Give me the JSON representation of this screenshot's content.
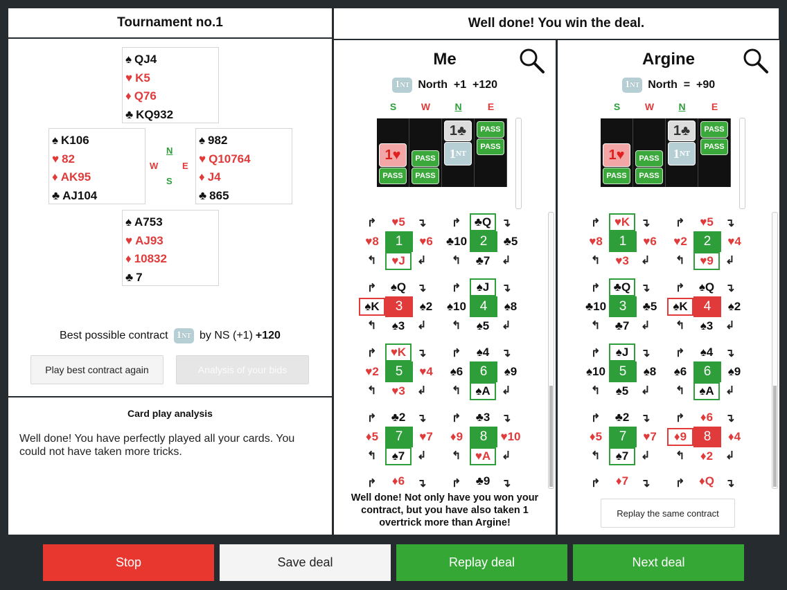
{
  "left": {
    "title": "Tournament no.1",
    "hands": {
      "north": {
        "s": "QJ4",
        "h": "K5",
        "d": "Q76",
        "c": "KQ932"
      },
      "west": {
        "s": "K106",
        "h": "82",
        "d": "AK95",
        "c": "AJ104"
      },
      "east": {
        "s": "982",
        "h": "Q10764",
        "d": "J4",
        "c": "865"
      },
      "south": {
        "s": "A753",
        "h": "AJ93",
        "d": "10832",
        "c": "7"
      }
    },
    "compass": {
      "n": "N",
      "w": "W",
      "e": "E",
      "s": "S"
    },
    "best_prefix": "Best possible contract",
    "best_nt": "1",
    "best_nt_suffix": "NT",
    "best_by": "by NS (+1)",
    "best_score": "+120",
    "play_again": "Play best contract again",
    "analysis_bids": "Analysis of your bids",
    "card_play_title": "Card play analysis",
    "card_play_text": "Well done! You have perfectly played all your cards. You could not have taken more tricks."
  },
  "right_title": "Well done! You win the deal.",
  "me": {
    "name": "Me",
    "contract_num": "1",
    "contract_suffix": "NT",
    "result": "North  +1  +120",
    "seats": [
      "S",
      "W",
      "N",
      "E"
    ],
    "tricks": [
      {
        "num": "1",
        "n": "♥5",
        "w": "♥8",
        "e": "♥6",
        "s": "♥J",
        "win": "s",
        "color": "green"
      },
      {
        "num": "2",
        "n": "♣Q",
        "w": "♣10",
        "e": "♣5",
        "s": "♣7",
        "win": "n",
        "color": "green"
      },
      {
        "num": "3",
        "n": "♠Q",
        "w": "♠K",
        "e": "♠2",
        "s": "♠3",
        "win": "w",
        "color": "red"
      },
      {
        "num": "4",
        "n": "♠J",
        "w": "♠10",
        "e": "♠8",
        "s": "♠5",
        "win": "n",
        "color": "green"
      },
      {
        "num": "5",
        "n": "♥K",
        "w": "♥2",
        "e": "♥4",
        "s": "♥3",
        "win": "n",
        "color": "green"
      },
      {
        "num": "6",
        "n": "♠4",
        "w": "♠6",
        "e": "♠9",
        "s": "♠A",
        "win": "s",
        "color": "green"
      },
      {
        "num": "7",
        "n": "♣2",
        "w": "♦5",
        "e": "♥7",
        "s": "♠7",
        "win": "s",
        "color": "green"
      },
      {
        "num": "8",
        "n": "♣3",
        "w": "♦9",
        "e": "♥10",
        "s": "♥A",
        "win": "s",
        "color": "green"
      }
    ],
    "partial": [
      "♦6",
      "♣9"
    ],
    "message": "Well done! Not only have you won your contract, but you have also taken 1 overtrick more than Argine!"
  },
  "argine": {
    "name": "Argine",
    "contract_num": "1",
    "contract_suffix": "NT",
    "result": "North  =  +90",
    "seats": [
      "S",
      "W",
      "N",
      "E"
    ],
    "tricks": [
      {
        "num": "1",
        "n": "♥K",
        "w": "♥8",
        "e": "♥6",
        "s": "♥3",
        "win": "n",
        "color": "green"
      },
      {
        "num": "2",
        "n": "♥5",
        "w": "♥2",
        "e": "♥4",
        "s": "♥9",
        "win": "s",
        "color": "green"
      },
      {
        "num": "3",
        "n": "♣Q",
        "w": "♣10",
        "e": "♣5",
        "s": "♣7",
        "win": "n",
        "color": "green"
      },
      {
        "num": "4",
        "n": "♠Q",
        "w": "♠K",
        "e": "♠2",
        "s": "♠3",
        "win": "w",
        "color": "red"
      },
      {
        "num": "5",
        "n": "♠J",
        "w": "♠10",
        "e": "♠8",
        "s": "♠5",
        "win": "n",
        "color": "green"
      },
      {
        "num": "6",
        "n": "♠4",
        "w": "♠6",
        "e": "♠9",
        "s": "♠A",
        "win": "s",
        "color": "green"
      },
      {
        "num": "7",
        "n": "♣2",
        "w": "♦5",
        "e": "♥7",
        "s": "♠7",
        "win": "s",
        "color": "green"
      },
      {
        "num": "8",
        "n": "♦6",
        "w": "♦9",
        "e": "♦4",
        "s": "♦2",
        "win": "w",
        "color": "red"
      }
    ],
    "partial": [
      "♦7",
      "♦Q"
    ],
    "replay": "Replay the same contract"
  },
  "buttons": {
    "stop": "Stop",
    "save": "Save deal",
    "replay": "Replay deal",
    "next": "Next deal"
  },
  "colors": {
    "green": "#2e9e3a",
    "red": "#e03a3a",
    "gray": "#f2f2f2"
  }
}
